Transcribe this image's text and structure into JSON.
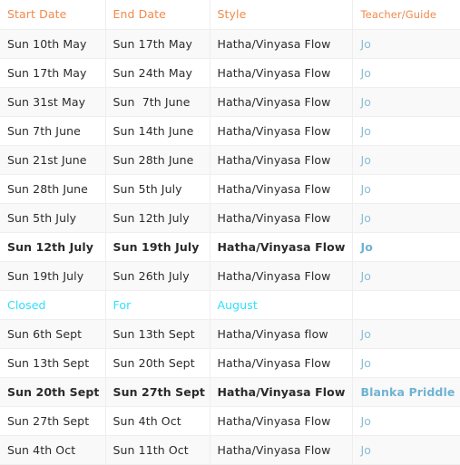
{
  "table": {
    "name": "yoga-class-schedule",
    "colors": {
      "header_text": "#f08a4b",
      "body_text": "#2b2b2b",
      "link_text": "#89bdd3",
      "closed_text": "#2fe0ff",
      "stripe_bg": "#f9f9f9",
      "row_bg": "#ffffff",
      "border": "#eeeeee"
    },
    "columns": [
      {
        "key": "start",
        "label": "Start Date"
      },
      {
        "key": "end",
        "label": "End Date"
      },
      {
        "key": "style",
        "label": "Style"
      },
      {
        "key": "teacher",
        "label": "Teacher/Guide"
      }
    ],
    "rows": [
      {
        "start": "Sun 10th May",
        "end": "Sun 17th May",
        "style": "Hatha/Vinyasa Flow",
        "teacher": "Jo",
        "bold": false,
        "closed": false,
        "stripe": true
      },
      {
        "start": "Sun 17th May",
        "end": "Sun 24th May",
        "style": "Hatha/Vinyasa Flow",
        "teacher": "Jo",
        "bold": false,
        "closed": false,
        "stripe": false
      },
      {
        "start": "Sun 31st May",
        "end": "Sun  7th June",
        "style": "Hatha/Vinyasa Flow",
        "teacher": "Jo",
        "bold": false,
        "closed": false,
        "stripe": true
      },
      {
        "start": "Sun 7th June",
        "end": "Sun 14th June",
        "style": "Hatha/Vinyasa Flow",
        "teacher": "Jo",
        "bold": false,
        "closed": false,
        "stripe": false
      },
      {
        "start": "Sun 21st June",
        "end": "Sun 28th June",
        "style": "Hatha/Vinyasa Flow",
        "teacher": "Jo",
        "bold": false,
        "closed": false,
        "stripe": true
      },
      {
        "start": "Sun 28th June",
        "end": "Sun 5th July",
        "style": "Hatha/Vinyasa Flow",
        "teacher": "Jo",
        "bold": false,
        "closed": false,
        "stripe": false
      },
      {
        "start": "Sun 5th July",
        "end": "Sun 12th July",
        "style": "Hatha/Vinyasa Flow",
        "teacher": "Jo",
        "bold": false,
        "closed": false,
        "stripe": true
      },
      {
        "start": "Sun 12th July",
        "end": "Sun 19th July",
        "style": "Hatha/Vinyasa Flow",
        "teacher": "Jo",
        "bold": true,
        "closed": false,
        "stripe": false
      },
      {
        "start": "Sun 19th July",
        "end": "Sun 26th July",
        "style": "Hatha/Vinyasa Flow",
        "teacher": "Jo",
        "bold": false,
        "closed": false,
        "stripe": true
      },
      {
        "start": "Closed",
        "end": "For",
        "style": "August",
        "teacher": "",
        "bold": false,
        "closed": true,
        "stripe": false
      },
      {
        "start": "Sun 6th Sept",
        "end": "Sun 13th Sept",
        "style": "Hatha/Vinyasa flow",
        "teacher": "Jo",
        "bold": false,
        "closed": false,
        "stripe": true
      },
      {
        "start": "Sun 13th Sept",
        "end": "Sun 20th Sept",
        "style": "Hatha/Vinyasa Flow",
        "teacher": "Jo",
        "bold": false,
        "closed": false,
        "stripe": false
      },
      {
        "start": "Sun 20th Sept",
        "end": "Sun 27th Sept",
        "style": "Hatha/Vinyasa Flow",
        "teacher": "Blanka Priddle",
        "bold": true,
        "closed": false,
        "stripe": true
      },
      {
        "start": "Sun 27th Sept",
        "end": "Sun 4th Oct",
        "style": "Hatha/Vinyasa Flow",
        "teacher": "Jo",
        "bold": false,
        "closed": false,
        "stripe": false
      },
      {
        "start": "Sun 4th Oct",
        "end": "Sun 11th Oct",
        "style": "Hatha/Vinyasa Flow",
        "teacher": "Jo",
        "bold": false,
        "closed": false,
        "stripe": true
      }
    ]
  }
}
